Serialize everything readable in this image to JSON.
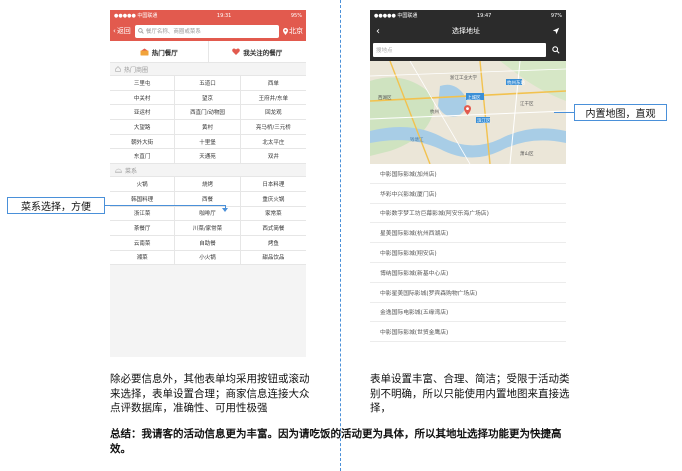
{
  "left_phone": {
    "status": {
      "carrier": "●●●●● 中国联通",
      "wifi": "⌔",
      "time": "19:31",
      "battery": "95%"
    },
    "header": {
      "back_label": "返回",
      "search_placeholder": "餐厅名称、商圈或菜系",
      "city": "北京"
    },
    "tabs": [
      {
        "label": "热门餐厅",
        "icon": "hot-restaurant-icon"
      },
      {
        "label": "我关注的餐厅",
        "icon": "heart-icon"
      }
    ],
    "section_hot_area": "热门商圈",
    "areas": [
      "三里屯",
      "五道口",
      "西单",
      "中关村",
      "望京",
      "王府井/东单",
      "亚运村",
      "西直门/动物园",
      "回龙观",
      "大望路",
      "黄村",
      "亮马桥/三元桥",
      "朝外大街",
      "十里堡",
      "北太平庄",
      "东直门",
      "天通苑",
      "双井"
    ],
    "section_cuisine": "菜系",
    "cuisines": [
      "火锅",
      "烧烤",
      "日本料理",
      "韩国料理",
      "西餐",
      "重庆火锅",
      "浙江菜",
      "咖啡厅",
      "家常菜",
      "茶餐厅",
      "川菜/家常菜",
      "西式简餐",
      "云南菜",
      "自助餐",
      "烤鱼",
      "湘菜",
      "小火锅",
      "甜品饮品"
    ]
  },
  "right_phone": {
    "status": {
      "carrier": "●●●●● 中国联通",
      "wifi": "⌔",
      "time": "19:47",
      "battery": "97%"
    },
    "header": {
      "title": "选择地址"
    },
    "search_placeholder": "搜地点",
    "map_labels": [
      "西湖区",
      "上城区",
      "浙江工业大学",
      "杭州东站",
      "江干区",
      "萧山区",
      "滨江区",
      "钱塘江",
      "杭州"
    ],
    "cinemas": [
      "中影国际影城(加州店)",
      "华彩中兴影城(厦门店)",
      "中影数字梦工坊巨幕影城(阿安乐海广场店)",
      "星美国际影城(杭州西湖店)",
      "中影国际影城(翔安店)",
      "博纳国际影城(新基中心店)",
      "中影星美国际影城(罗宾森购物广场店)",
      "金逸国际电影城(五缘湾店)",
      "中影国际影城(世贸金鹰店)"
    ]
  },
  "callouts": {
    "left": "菜系选择，方便",
    "right": "内置地图，直观"
  },
  "descriptions": {
    "left": "除必要信息外，其他表单均采用按钮或滚动来选择，表单设置合理；商家信息连接大众点评数据库，准确性、可用性极强",
    "right": "表单设置丰富、合理、简洁；受限于活动类别不明确，所以只能使用内置地图来直接选择，"
  },
  "summary": "总结：我请客的活动信息更为丰富。因为请吃饭的活动更为具体，所以其地址选择功能更为快捷高效。",
  "colors": {
    "left_header": "#e25a4e",
    "right_header": "#2b2b2b",
    "callout_border": "#4a90d9"
  }
}
